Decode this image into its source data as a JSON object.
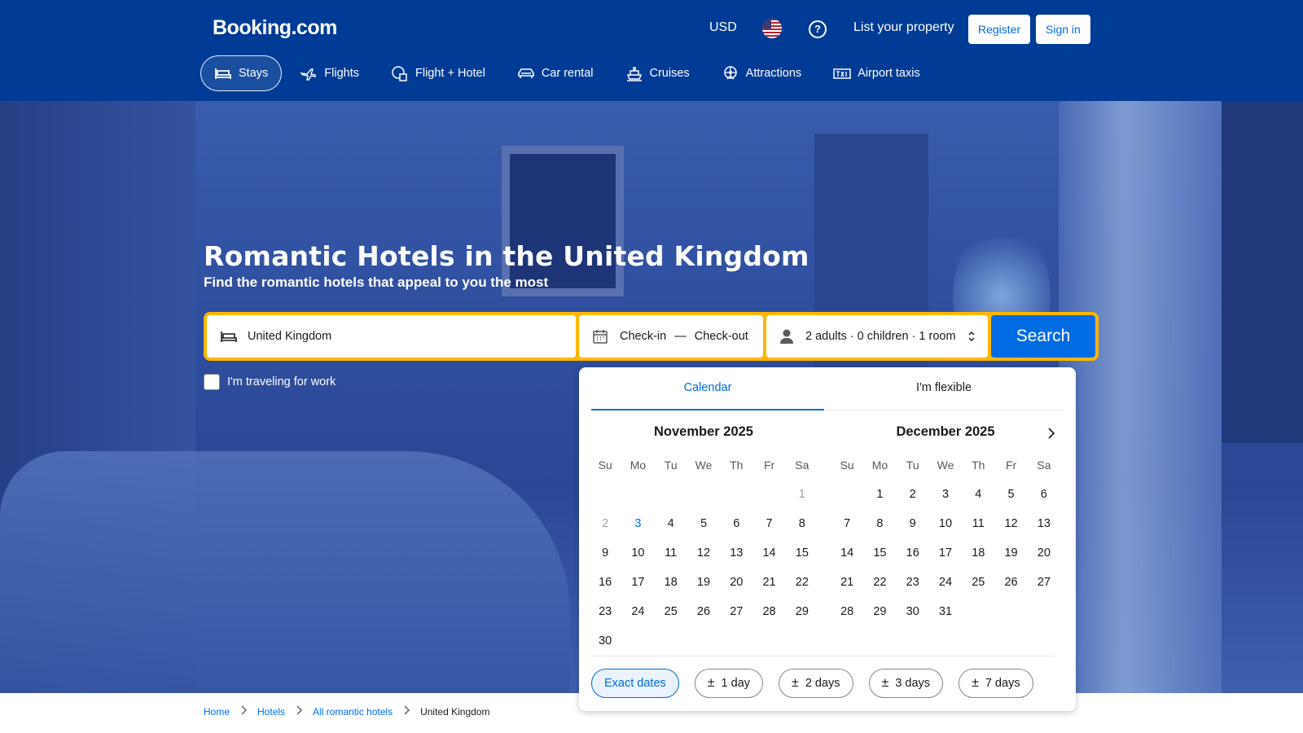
{
  "header": {
    "logo": "Booking.com",
    "currency": "USD",
    "flag_icon": "us-flag-icon",
    "list_property": "List your property",
    "register": "Register",
    "sign_in": "Sign in",
    "brand_color": "#003b95"
  },
  "nav": [
    {
      "label": "Stays",
      "icon": "bed-icon"
    },
    {
      "label": "Flights",
      "icon": "plane-icon"
    },
    {
      "label": "Flight + Hotel",
      "icon": "flight-hotel-icon"
    },
    {
      "label": "Car rental",
      "icon": "car-icon"
    },
    {
      "label": "Cruises",
      "icon": "ship-icon"
    },
    {
      "label": "Attractions",
      "icon": "attractions-icon"
    },
    {
      "label": "Airport taxis",
      "icon": "taxi-icon"
    }
  ],
  "hero": {
    "title": "Romantic Hotels in the United Kingdom",
    "subtitle": "Find the romantic hotels that appeal to you the most"
  },
  "search": {
    "destination": "United Kingdom",
    "checkin": "Check-in",
    "checkout": "Check-out",
    "guests": "2 adults · 0 children · 1 room",
    "button": "Search",
    "work_label": "I'm traveling for work",
    "accent": "#ffb700"
  },
  "calendar": {
    "tab_calendar": "Calendar",
    "tab_flexible": "I'm flexible",
    "weekdays": [
      "Su",
      "Mo",
      "Tu",
      "We",
      "Th",
      "Fr",
      "Sa"
    ],
    "months": [
      {
        "title": "November 2025",
        "weeks": [
          [
            "",
            "",
            "",
            "",
            "",
            "",
            "1"
          ],
          [
            "2",
            "3",
            "4",
            "5",
            "6",
            "7",
            "8"
          ],
          [
            "9",
            "10",
            "11",
            "12",
            "13",
            "14",
            "15"
          ],
          [
            "16",
            "17",
            "18",
            "19",
            "20",
            "21",
            "22"
          ],
          [
            "23",
            "24",
            "25",
            "26",
            "27",
            "28",
            "29"
          ],
          [
            "30",
            "",
            "",
            "",
            "",
            "",
            ""
          ]
        ],
        "past_days": [
          "1",
          "2"
        ],
        "today": "3"
      },
      {
        "title": "December 2025",
        "weeks": [
          [
            "",
            "1",
            "2",
            "3",
            "4",
            "5",
            "6"
          ],
          [
            "7",
            "8",
            "9",
            "10",
            "11",
            "12",
            "13"
          ],
          [
            "14",
            "15",
            "16",
            "17",
            "18",
            "19",
            "20"
          ],
          [
            "21",
            "22",
            "23",
            "24",
            "25",
            "26",
            "27"
          ],
          [
            "28",
            "29",
            "30",
            "31",
            "",
            "",
            ""
          ]
        ],
        "past_days": [],
        "today": ""
      }
    ],
    "chips": [
      "Exact dates",
      "1 day",
      "2 days",
      "3 days",
      "7 days"
    ],
    "chip_prefix": "±"
  },
  "breadcrumb": [
    "Home",
    "Hotels",
    "All romantic hotels",
    "United Kingdom"
  ]
}
